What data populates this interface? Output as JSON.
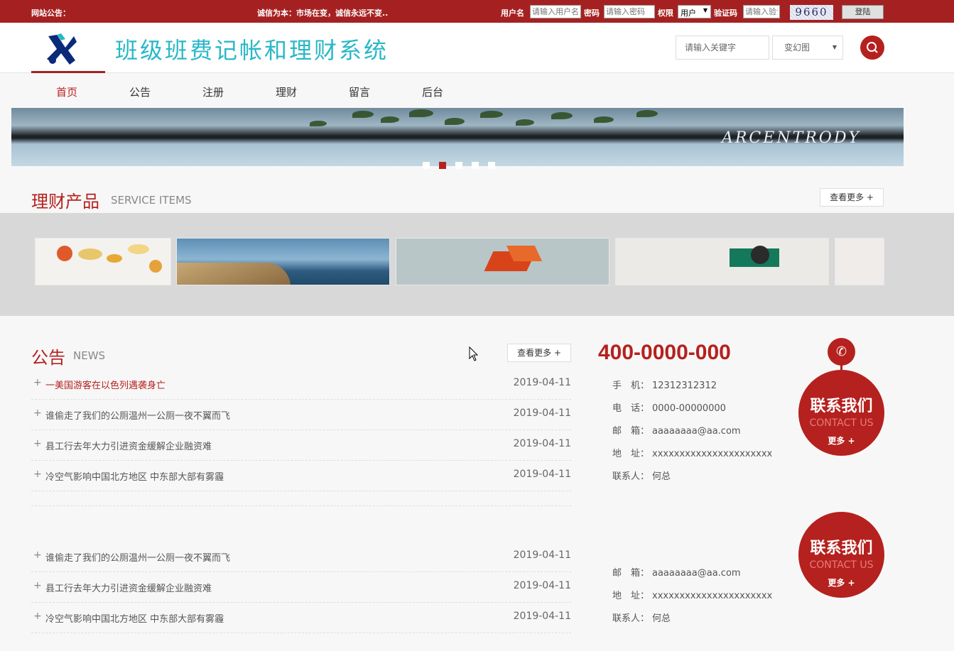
{
  "topbar": {
    "notice_label": "网站公告：",
    "notice_text": "诚信为本：市场在变，诚信永远不变..",
    "username_label": "用户名",
    "username_placeholder": "请输入用户名",
    "password_label": "密码",
    "password_placeholder": "请输入密码",
    "role_label": "权限",
    "role_value": "用户",
    "captcha_label": "验证码",
    "captcha_placeholder": "请输入验证码",
    "captcha_code": "9660",
    "login_label": "登陆"
  },
  "header": {
    "site_title": "班级班费记帐和理财系统",
    "search_placeholder": "请输入关键字",
    "search_select_value": "变幻图"
  },
  "nav": {
    "items": [
      "首页",
      "公告",
      "注册",
      "理财",
      "留言",
      "后台"
    ]
  },
  "banner": {
    "sign_text": "ARCENTRODY"
  },
  "products": {
    "title": "理财产品",
    "subtitle": "SERVICE ITEMS",
    "more": "查看更多 +"
  },
  "news": {
    "title": "公告",
    "subtitle": "NEWS",
    "more": "查看更多 +",
    "items": [
      {
        "title": "一美国游客在以色列遇袭身亡",
        "date": "2019-04-11"
      },
      {
        "title": "谁偷走了我们的公厕温州一公厕一夜不翼而飞",
        "date": "2019-04-11"
      },
      {
        "title": "县工行去年大力引进资金缓解企业融资难",
        "date": "2019-04-11"
      },
      {
        "title": "冷空气影响中国北方地区 中东部大部有雾霾",
        "date": "2019-04-11"
      },
      {
        "title": "谁偷走了我们的公厕温州一公厕一夜不翼而飞",
        "date": "2019-04-11"
      },
      {
        "title": "县工行去年大力引进资金缓解企业融资难",
        "date": "2019-04-11"
      },
      {
        "title": "冷空气影响中国北方地区 中东部大部有雾霾",
        "date": "2019-04-11"
      }
    ]
  },
  "contact": {
    "phone_big": "400-0000-000",
    "mobile_label": "手　机：",
    "mobile": "12312312312",
    "tel_label": "电　话：",
    "tel": "0000-00000000",
    "email_label": "邮　箱：",
    "email": "aaaaaaaa@aa.com",
    "address_label": "地　址：",
    "address": "xxxxxxxxxxxxxxxxxxxxxx",
    "person_label": "联系人：",
    "person": "何总",
    "badge_title": "联系我们",
    "badge_sub": "CONTACT US",
    "badge_more": "更多 +"
  },
  "colors": {
    "brand_red": "#a52121",
    "accent_red": "#b5211e",
    "title_cyan": "#29b7c8"
  }
}
